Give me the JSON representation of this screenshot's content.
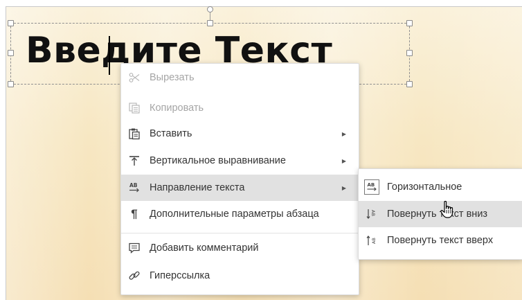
{
  "slide": {
    "title_text": "Введите Текст"
  },
  "context_menu": {
    "items": [
      {
        "label": "Вырезать",
        "icon": "scissors-icon",
        "disabled": true
      },
      {
        "label": "Копировать",
        "icon": "copy-icon",
        "disabled": true
      },
      {
        "label": "Вставить",
        "icon": "paste-icon",
        "submenu": true
      },
      {
        "label": "Вертикальное выравнивание",
        "icon": "vertical-align-top-icon",
        "submenu": true
      },
      {
        "label": "Направление текста",
        "icon": "text-direction-icon",
        "submenu": true,
        "highlighted": true
      },
      {
        "label": "Дополнительные параметры абзаца",
        "icon": "pilcrow-icon"
      },
      {
        "label": "Добавить комментарий",
        "icon": "comment-icon"
      },
      {
        "label": "Гиперссылка",
        "icon": "link-icon"
      }
    ]
  },
  "text_direction_submenu": {
    "items": [
      {
        "label": "Горизонтальное",
        "icon": "horizontal-text-icon",
        "selected": true
      },
      {
        "label": "Повернуть текст вниз",
        "icon": "rotate-text-down-icon",
        "highlighted": true
      },
      {
        "label": "Повернуть текст вверх",
        "icon": "rotate-text-up-icon"
      }
    ]
  },
  "colors": {
    "menu_highlight": "#e1e1e1",
    "disabled_text": "#a5a5a5",
    "text": "#333333"
  }
}
